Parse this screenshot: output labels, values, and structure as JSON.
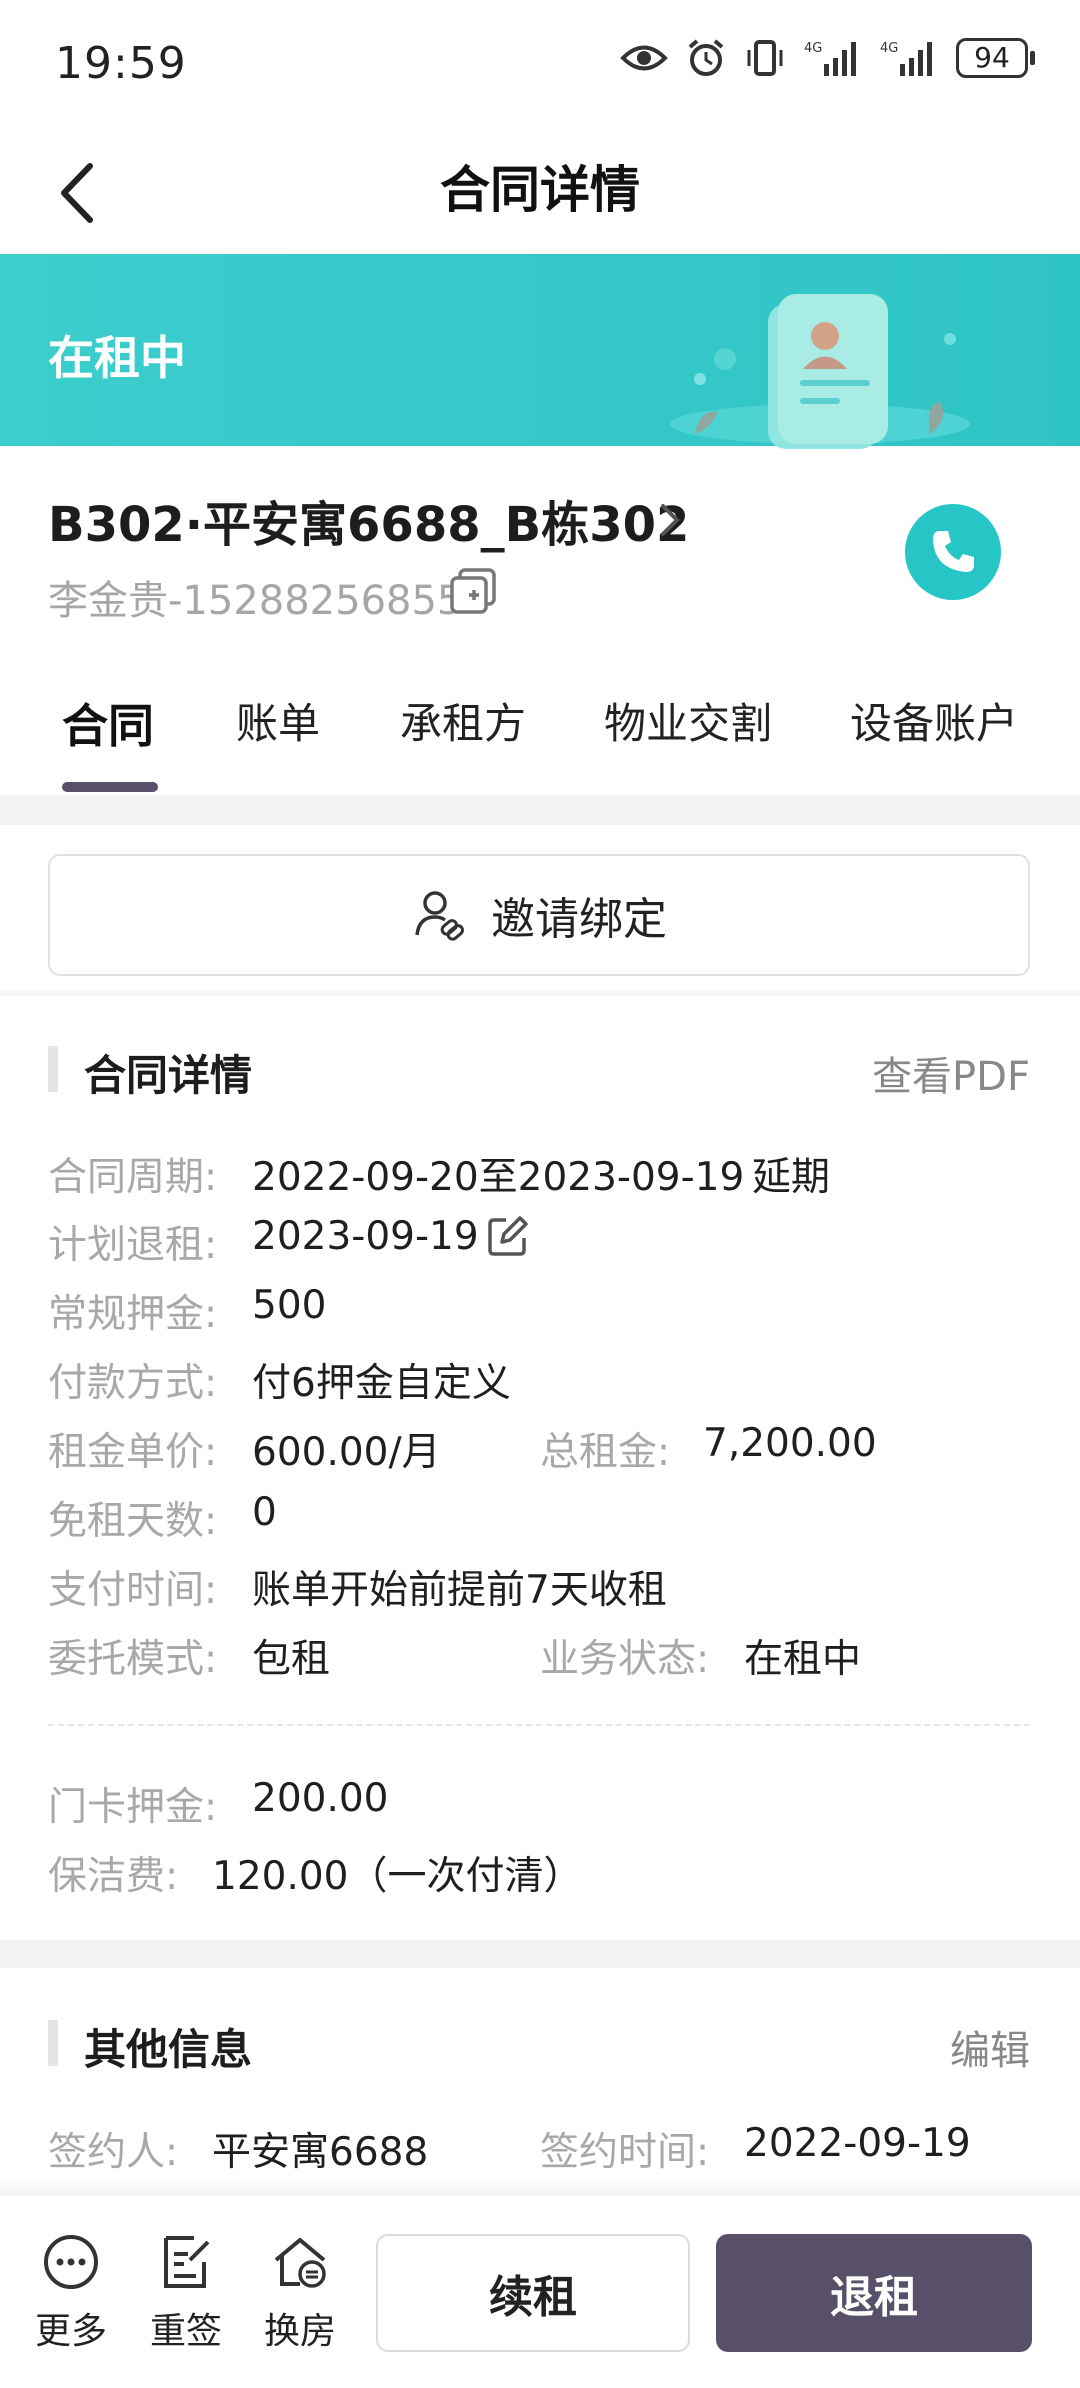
{
  "status_bar": {
    "time": "19:59",
    "battery": "94",
    "icons": [
      "eye-icon",
      "alarm-icon",
      "vibrate-icon",
      "signal-4g-icon",
      "signal-4g-icon",
      "battery-icon"
    ]
  },
  "nav": {
    "title": "合同详情"
  },
  "banner": {
    "status": "在租中"
  },
  "property": {
    "name": "B302·平安寓6688_B栋302",
    "tenant": "李金贵-15288256855"
  },
  "tabs": [
    "合同",
    "账单",
    "承租方",
    "物业交割",
    "设备账户"
  ],
  "invite": {
    "label": "邀请绑定"
  },
  "contract_section": {
    "title": "合同详情",
    "link": "查看PDF",
    "rows": {
      "period_label": "合同周期:",
      "period_value": "2022-09-20至2023-09-19",
      "period_tag": "延期",
      "planned_checkout_label": "计划退租:",
      "planned_checkout_value": "2023-09-19",
      "deposit_label": "常规押金:",
      "deposit_value": "500",
      "payment_label": "付款方式:",
      "payment_value": "付6押金自定义",
      "unit_price_label": "租金单价:",
      "unit_price_value": "600.00/月",
      "total_label": "总租金:",
      "total_value": "7,200.00",
      "free_days_label": "免租天数:",
      "free_days_value": "0",
      "pay_time_label": "支付时间:",
      "pay_time_value": "账单开始前提前7天收租",
      "mode_label": "委托模式:",
      "mode_value": "包租",
      "biz_status_label": "业务状态:",
      "biz_status_value": "在租中",
      "card_deposit_label": "门卡押金:",
      "card_deposit_value": "200.00",
      "cleaning_label": "保洁费:",
      "cleaning_value": "120.00（一次付清）"
    }
  },
  "other_section": {
    "title": "其他信息",
    "link": "编辑",
    "signer_label": "签约人:",
    "signer_value": "平安寓6688",
    "sign_time_label": "签约时间:",
    "sign_time_value": "2022-09-19"
  },
  "bottom_bar": {
    "more": "更多",
    "resign": "重签",
    "change_room": "换房",
    "renew": "续租",
    "checkout": "退租"
  },
  "colors": {
    "accent": "#27c6c6",
    "banner": "#3ccdcd",
    "primary_button": "#575068",
    "label_gray": "#a8a8a8"
  }
}
